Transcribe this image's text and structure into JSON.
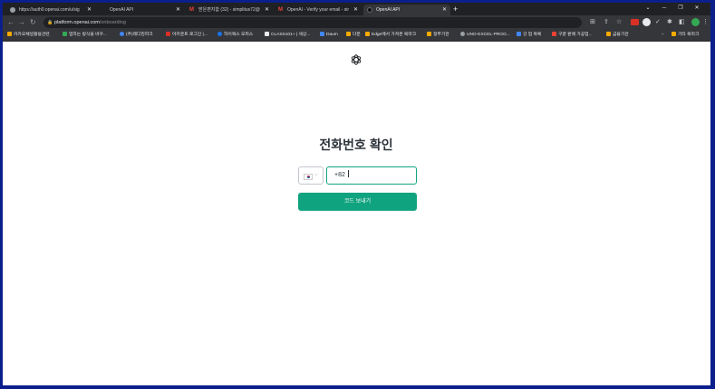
{
  "tabs": [
    {
      "title": "https://auth0.openai.com/u/sig"
    },
    {
      "title": "OpenAI API"
    },
    {
      "title": "받은편지함 (32) - simplitus72@"
    },
    {
      "title": "OpenAI - Verify your email - sir"
    },
    {
      "title": "OpenAI API"
    }
  ],
  "address": {
    "domain": "platform.openai.com",
    "path": "/onboarding"
  },
  "bookmarks": [
    {
      "label": "카카오채널활용관련"
    },
    {
      "label": "업하는 방식을 바꾸..."
    },
    {
      "label": "(주)레디킹파크"
    },
    {
      "label": "아카운트 로그인 |..."
    },
    {
      "label": "하이웍스 오피스"
    },
    {
      "label": "CLASS101+ | 세상..."
    },
    {
      "label": "Daum"
    },
    {
      "label": "다운"
    },
    {
      "label": "Edge에서 가져온 북마크"
    },
    {
      "label": "정부기관"
    },
    {
      "label": "UNO-EXCEL-PROG..."
    },
    {
      "label": "강 업 목록"
    },
    {
      "label": "구글 판례 가공업..."
    },
    {
      "label": "금융기관"
    },
    {
      "label": "기타 북마크"
    }
  ],
  "page": {
    "title": "전화번호 확인",
    "phone_value": "+82",
    "send_label": "코드 보내기"
  },
  "colors": {
    "accent": "#10a37f",
    "frame": "#0b1f8c"
  }
}
